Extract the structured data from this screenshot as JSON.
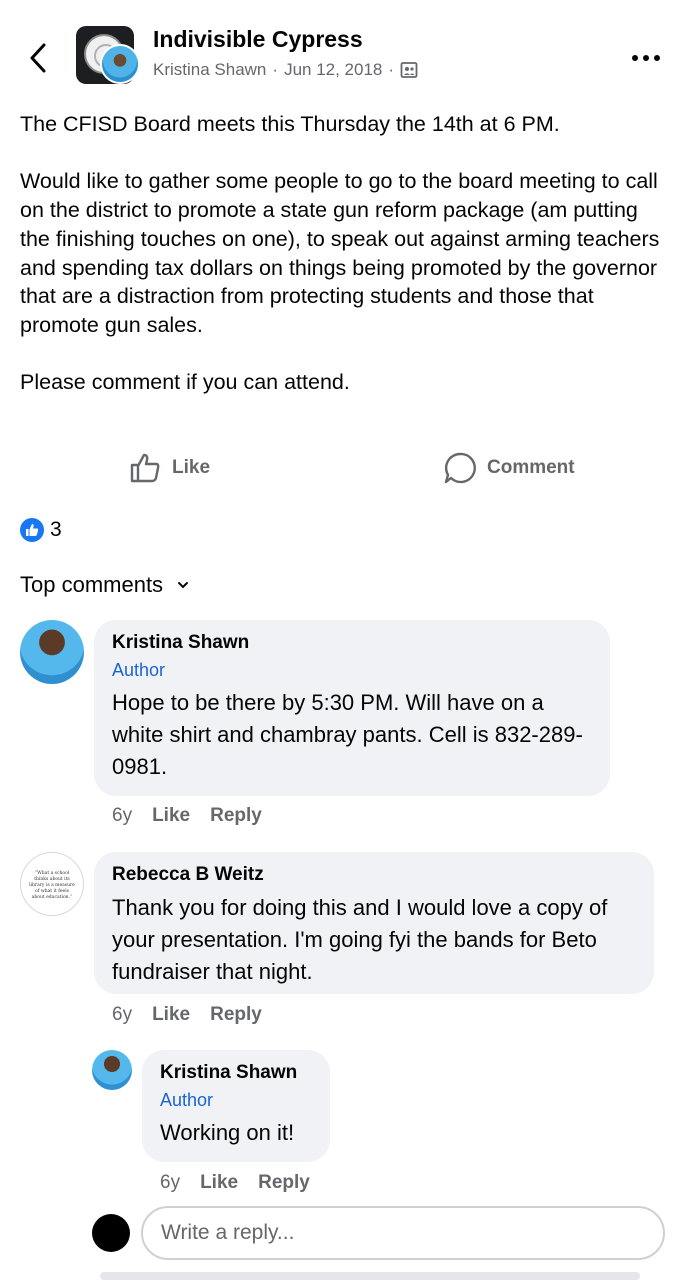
{
  "header": {
    "group_name": "Indivisible Cypress",
    "author": "Kristina Shawn",
    "separator": "·",
    "date": "Jun 12, 2018",
    "separator2": "·",
    "audience_icon": "group-audience-icon"
  },
  "post": {
    "paragraphs": [
      "The CFISD Board meets this Thursday the 14th at 6 PM.",
      "Would like to gather some people to go to the board meeting to call on the district to promote a state gun reform package (am putting the finishing touches on one), to speak out against arming teachers and spending tax dollars on things being promoted by the governor that are a distraction from protecting students and those that promote gun sales.",
      "Please comment if you can attend."
    ]
  },
  "actions": {
    "like_label": "Like",
    "comment_label": "Comment"
  },
  "reactions": {
    "count": "3"
  },
  "comments_section": {
    "sort_label": "Top comments"
  },
  "comments": [
    {
      "name": "Kristina Shawn",
      "badge": "Author",
      "text": "Hope to be there by 5:30 PM. Will have on a white shirt and chambray pants. Cell is 832-289-0981.",
      "time": "6y",
      "like": "Like",
      "reply": "Reply"
    },
    {
      "name": "Rebecca B Weitz",
      "text": "Thank you for doing this and I would love a copy of your presentation. I'm going fyi the bands for Beto fundraiser that night.",
      "time": "6y",
      "like": "Like",
      "reply": "Reply"
    },
    {
      "name": "Kristina Shawn",
      "badge": "Author",
      "text": "Working on it!",
      "time": "6y",
      "like": "Like",
      "reply": "Reply"
    }
  ],
  "reply_box": {
    "placeholder": "Write a reply..."
  },
  "colors": {
    "accent_blue": "#1877f2",
    "author_blue": "#1b64d6",
    "bubble_bg": "#f0f2f5",
    "secondary_text": "#65676b"
  }
}
